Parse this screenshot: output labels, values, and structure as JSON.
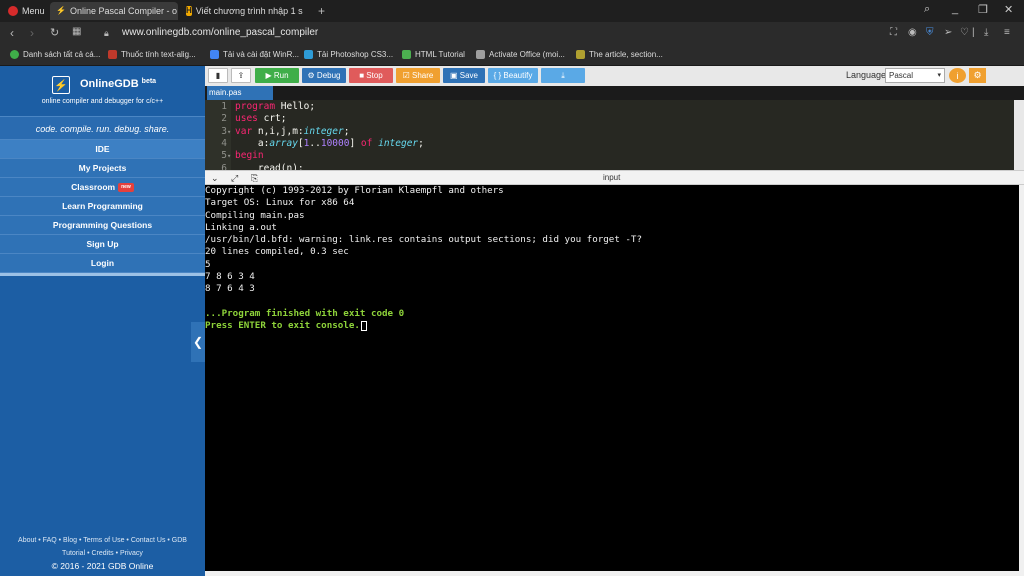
{
  "browser": {
    "menu_label": "Menu",
    "tabs": [
      {
        "label": "Online Pascal Compiler - o",
        "icon_color": "#1c5ea4"
      },
      {
        "label": "Viết chương trình nhập 1 s",
        "icon_color": "#f2a900"
      }
    ],
    "new_tab": "+",
    "url": "www.onlinegdb.com/online_pascal_compiler",
    "bookmarks": [
      {
        "label": "Danh sách tất cả cá...",
        "color": "#3fae49"
      },
      {
        "label": "Thuốc tính text-alig...",
        "color": "#c0392b"
      },
      {
        "label": "Tải và cài đặt WinR...",
        "color": "#4285f4"
      },
      {
        "label": "Tải Photoshop CS3...",
        "color": "#2e9bd6"
      },
      {
        "label": "HTML Tutorial",
        "color": "#4caf50"
      },
      {
        "label": "Activate Office (moi...",
        "color": "#9e9e9e"
      },
      {
        "label": "The article, section...",
        "color": "#b0a030"
      }
    ]
  },
  "sidebar": {
    "brand": "OnlineGDB",
    "beta": "beta",
    "subtitle": "online compiler and debugger for c/c++",
    "tagline": "code. compile. run. debug. share.",
    "nav": [
      {
        "label": "IDE"
      },
      {
        "label": "My Projects"
      },
      {
        "label": "Classroom",
        "badge": "new"
      },
      {
        "label": "Learn Programming"
      },
      {
        "label": "Programming Questions"
      },
      {
        "label": "Sign Up"
      },
      {
        "label": "Login"
      }
    ],
    "footer_line1": "About • FAQ • Blog • Terms of Use • Contact Us • GDB",
    "footer_line2": "Tutorial • Credits • Privacy",
    "copyright": "© 2016 - 2021 GDB Online"
  },
  "toolbar": {
    "run": "▶ Run",
    "debug": "⚙ Debug",
    "stop": "■ Stop",
    "share": "☑ Share",
    "save": "▣ Save",
    "beautify": "{ } Beautify",
    "download": "⤓",
    "language_label": "Language",
    "language_value": "Pascal",
    "colors": {
      "run": "#3fae49",
      "debug": "#2f72b6",
      "stop": "#e05b5b",
      "share": "#f0a030",
      "save": "#2f72b6",
      "beautify": "#5aa9e6",
      "download": "#5aa9e6"
    }
  },
  "editor": {
    "file_tab": "main.pas",
    "lines": [
      {
        "n": "1",
        "fold": "",
        "html": "<span class='kw'>program</span> Hello;"
      },
      {
        "n": "2",
        "fold": "",
        "html": "<span class='kw'>uses</span> crt;"
      },
      {
        "n": "3",
        "fold": "▾",
        "html": "<span class='kw'>var</span> n,i,j,m:<span class='tp'>integer</span>;"
      },
      {
        "n": "4",
        "fold": "",
        "html": "    a:<span class='tp'>array</span>[<span class='num'>1</span>..<span class='num'>10000</span>] <span class='kw'>of</span> <span class='tp'>integer</span>;"
      },
      {
        "n": "5",
        "fold": "▾",
        "html": "<span class='kw'>begin</span>"
      },
      {
        "n": "6",
        "fold": "",
        "html": "    read(n);"
      }
    ]
  },
  "io": {
    "input_label": "input"
  },
  "console": {
    "lines": [
      "Copyright (c) 1993-2012 by Florian Klaempfl and others",
      "Target OS: Linux for x86 64",
      "Compiling main.pas",
      "Linking a.out",
      "/usr/bin/ld.bfd: warning: link.res contains output sections; did you forget -T?",
      "20 lines compiled, 0.3 sec",
      "5",
      "7 8 6 3 4",
      "8 7 6 4 3",
      ""
    ],
    "finish": "...Program finished with exit code 0",
    "press": "Press ENTER to exit console."
  }
}
